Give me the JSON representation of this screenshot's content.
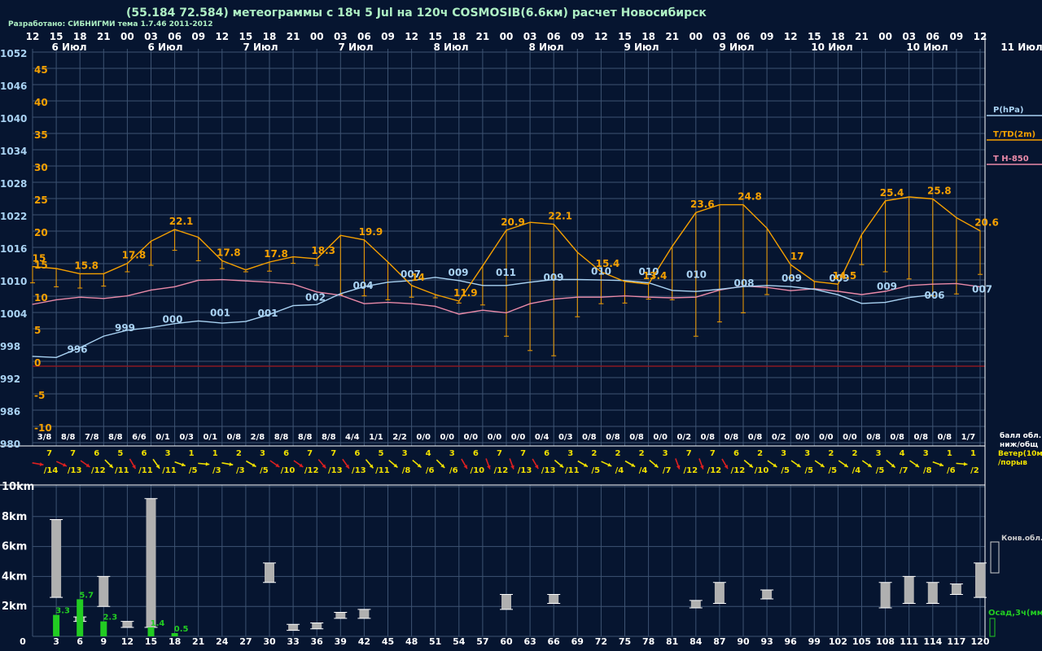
{
  "header": {
    "title": "(55.184 72.584) метеограммы с  18ч 5 Jul на 120ч COSMOSIB(6.6км) расчет Новосибирск",
    "credits": "Разработано: СИБНИГМИ тема 1.7.46 2011-2012"
  },
  "colors": {
    "background": "#061530",
    "grid": "#3d5372",
    "pressure": "#a9d2f2",
    "temperature": "#f5a000",
    "t850": "#ea8aa8",
    "zero_line": "#8a1a22",
    "cloud_bar": "#b0b0b0",
    "precip_bar": "#22cc22",
    "wind_calm": "#f0e000",
    "wind_strong": "#dd2020"
  },
  "chart_data": [
    {
      "type": "line",
      "name": "meteogram-main",
      "hour_ticks": [
        "12",
        "15",
        "18",
        "21",
        "00",
        "03",
        "06",
        "09",
        "12",
        "15",
        "18",
        "21",
        "00",
        "03",
        "06",
        "09",
        "12",
        "15",
        "18",
        "21",
        "00",
        "03",
        "06",
        "09",
        "12",
        "15",
        "18",
        "21",
        "00",
        "03",
        "06",
        "09",
        "12",
        "15",
        "18",
        "21",
        "00",
        "03",
        "06",
        "09",
        "12"
      ],
      "day_labels": [
        "6 Июл",
        "6 Июл",
        "7 Июл",
        "7 Июл",
        "8 Июл",
        "8 Июл",
        "9 Июл",
        "9 Июл",
        "10 Июл",
        "10 Июл",
        "11 Июл"
      ],
      "pressure_axis_label": "P(hPa)",
      "temp_axis_label": "T/TD(2m)",
      "t850_axis_label": "T H-850",
      "pressure_ticks": [
        "1052",
        "1046",
        "1040",
        "1034",
        "1028",
        "1022",
        "1016",
        "1010",
        "1004",
        "998",
        "992",
        "986",
        "980"
      ],
      "temp_ticks": [
        "45",
        "40",
        "35",
        "30",
        "25",
        "20",
        "15",
        "10",
        "5",
        "0",
        "-5",
        "-10"
      ],
      "pressure_hpa": [
        996.8,
        996.6,
        998.4,
        1000.5,
        1001.6,
        1002.1,
        1002.8,
        1003.3,
        1002.9,
        1003.2,
        1004.5,
        1006.1,
        1006.3,
        1008.3,
        1009.6,
        1010.4,
        1010.7,
        1011.3,
        1010.7,
        1009.8,
        1009.8,
        1010.4,
        1010.9,
        1010.9,
        1010.8,
        1010.7,
        1010.3,
        1008.9,
        1008.7,
        1009.1,
        1009.6,
        1009.8,
        1009.6,
        1009.1,
        1008.1,
        1006.5,
        1006.7,
        1007.6,
        1008.1
      ],
      "temperature_c": [
        15.3,
        15.0,
        14.2,
        14.2,
        15.8,
        19.2,
        21.0,
        19.8,
        16.2,
        14.8,
        16.0,
        16.8,
        16.5,
        20.1,
        19.4,
        16.0,
        12.4,
        11.0,
        10.0,
        15.4,
        20.9,
        22.1,
        21.8,
        17.5,
        14.5,
        13.0,
        12.6,
        18.4,
        23.6,
        24.8,
        24.8,
        21.2,
        15.6,
        13.0,
        12.6,
        20.2,
        25.4,
        26.0,
        25.7,
        22.8,
        20.8
      ],
      "dewpoint_c": [
        12.8,
        12.2,
        12.0,
        12.3,
        14.5,
        15.5,
        17.8,
        16.2,
        15.0,
        14.5,
        14.6,
        15.8,
        15.5,
        11.0,
        10.8,
        10.2,
        10.6,
        10.5,
        9.7,
        9.4,
        4.6,
        2.4,
        1.6,
        7.6,
        9.6,
        9.7,
        10.3,
        10.2,
        4.6,
        6.8,
        8.2,
        11.0,
        13.6,
        11.8,
        11.5,
        15.6,
        14.5,
        13.4,
        10.8,
        11.1,
        14.1
      ],
      "t850_c": [
        9.5,
        10.2,
        10.6,
        10.4,
        10.8,
        11.7,
        12.2,
        13.2,
        13.3,
        13.1,
        12.9,
        12.6,
        11.4,
        10.9,
        9.6,
        9.8,
        9.6,
        9.2,
        8.0,
        8.6,
        8.2,
        9.6,
        10.3,
        10.6,
        10.6,
        10.8,
        10.6,
        10.5,
        10.6,
        11.7,
        12.3,
        12.1,
        11.6,
        11.9,
        11.5,
        11.0,
        11.5,
        12.4,
        12.6,
        12.7,
        12.2
      ],
      "pressure_labels": [
        {
          "h": 6,
          "v": "996"
        },
        {
          "h": 15,
          "v": "999"
        },
        {
          "h": 24,
          "v": "000"
        },
        {
          "h": 33,
          "v": "001"
        },
        {
          "h": 42,
          "v": "001"
        },
        {
          "h": 51,
          "v": "002"
        },
        {
          "h": 60,
          "v": "004"
        },
        {
          "h": 69,
          "v": "007"
        },
        {
          "h": 78,
          "v": "009"
        },
        {
          "h": 87,
          "v": "011"
        },
        {
          "h": 96,
          "v": "009"
        },
        {
          "h": 105,
          "v": "010"
        },
        {
          "h": 114,
          "v": "010"
        },
        {
          "h": 123,
          "v": "010"
        },
        {
          "h": 132,
          "v": "008"
        },
        {
          "h": 141,
          "v": "009"
        },
        {
          "h": 150,
          "v": "009"
        },
        {
          "h": 159,
          "v": "009"
        },
        {
          "h": 168,
          "v": "006"
        },
        {
          "h": 177,
          "v": "007"
        }
      ],
      "temperature_labels": [
        {
          "h": 0,
          "v": "15"
        },
        {
          "h": 9,
          "v": "15.8"
        },
        {
          "h": 18,
          "v": "17.8"
        },
        {
          "h": 27,
          "v": "22.1"
        },
        {
          "h": 36,
          "v": "17.8"
        },
        {
          "h": 45,
          "v": "17.8"
        },
        {
          "h": 54,
          "v": "18.3"
        },
        {
          "h": 63,
          "v": "19.9"
        },
        {
          "h": 72,
          "v": "14"
        },
        {
          "h": 81,
          "v": "11.9"
        },
        {
          "h": 90,
          "v": "20.9"
        },
        {
          "h": 99,
          "v": "22.1"
        },
        {
          "h": 108,
          "v": "15.4"
        },
        {
          "h": 117,
          "v": "13.4"
        },
        {
          "h": 126,
          "v": "23.6"
        },
        {
          "h": 135,
          "v": "24.8"
        },
        {
          "h": 144,
          "v": "17"
        },
        {
          "h": 153,
          "v": "14.5"
        },
        {
          "h": 162,
          "v": "25.4"
        },
        {
          "h": 171,
          "v": "25.8"
        },
        {
          "h": 180,
          "v": "20.6"
        }
      ],
      "cloud_cover": [
        "3/8",
        "8/8",
        "7/8",
        "8/8",
        "6/6",
        "0/1",
        "0/3",
        "0/1",
        "0/8",
        "2/8",
        "8/8",
        "8/8",
        "8/8",
        "4/4",
        "1/1",
        "2/2",
        "0/0",
        "0/0",
        "0/0",
        "0/0",
        "0/0",
        "0/4",
        "0/3",
        "0/8",
        "0/8",
        "0/8",
        "0/0",
        "0/2",
        "0/8",
        "0/8",
        "0/8",
        "0/2",
        "0/0",
        "0/0",
        "0/0",
        "0/8",
        "0/8",
        "0/8",
        "0/8",
        "1/7"
      ],
      "cloud_cover_label": [
        "балл обл.",
        "ниж/общ"
      ]
    },
    {
      "type": "wind",
      "name": "wind-row",
      "label": [
        "Ветер(10м)",
        "/порыв"
      ],
      "speed": [
        "7",
        "7",
        "6",
        "5",
        "6",
        "3",
        "1",
        "1",
        "2",
        "3",
        "6",
        "7",
        "7",
        "6",
        "5",
        "3",
        "4",
        "3",
        "6",
        "7",
        "7",
        "6",
        "3",
        "2",
        "2",
        "2",
        "3",
        "7",
        "7",
        "6",
        "2",
        "3",
        "3",
        "2",
        "2",
        "3",
        "4",
        "3",
        "1",
        "1"
      ],
      "gust": [
        "/14",
        "/13",
        "/12",
        "/11",
        "/11",
        "/11",
        "/5",
        "/3",
        "/3",
        "/5",
        "/10",
        "/12",
        "/13",
        "/13",
        "/11",
        "/8",
        "/6",
        "/6",
        "/10",
        "/12",
        "/13",
        "/13",
        "/11",
        "/5",
        "/4",
        "/4",
        "/7",
        "/12",
        "/12",
        "/12",
        "/10",
        "/5",
        "/5",
        "/5",
        "/4",
        "/5",
        "/7",
        "/8",
        "/6",
        "/2"
      ],
      "direction_deg": [
        100,
        115,
        125,
        135,
        150,
        145,
        110,
        95,
        100,
        120,
        125,
        125,
        140,
        145,
        140,
        130,
        130,
        135,
        150,
        160,
        160,
        150,
        130,
        120,
        115,
        120,
        130,
        160,
        160,
        150,
        130,
        125,
        125,
        125,
        125,
        125,
        130,
        125,
        110,
        95
      ]
    },
    {
      "type": "bar",
      "name": "clouds-precip",
      "x_ticks": [
        "0",
        "3",
        "6",
        "9",
        "12",
        "15",
        "18",
        "21",
        "24",
        "27",
        "30",
        "33",
        "36",
        "39",
        "42",
        "45",
        "48",
        "51",
        "54",
        "57",
        "60",
        "63",
        "66",
        "69",
        "72",
        "75",
        "78",
        "81",
        "84",
        "87",
        "90",
        "93",
        "96",
        "99",
        "102",
        "105",
        "108",
        "111",
        "114",
        "117",
        "120"
      ],
      "height_ticks": [
        "10km",
        "8km",
        "6km",
        "4km",
        "2km"
      ],
      "ylim_km": [
        0,
        10
      ],
      "cloud_label": "Конв.обл.",
      "precip_label": "Осад,3ч(мм)",
      "clouds": [
        {
          "x": 3,
          "base": 2.6,
          "top": 7.8
        },
        {
          "x": 6,
          "base": 1.0,
          "top": 1.3
        },
        {
          "x": 9,
          "base": 2.0,
          "top": 4.0
        },
        {
          "x": 12,
          "base": 0.6,
          "top": 1.0
        },
        {
          "x": 15,
          "base": 0.6,
          "top": 9.2
        },
        {
          "x": 30,
          "base": 3.6,
          "top": 4.9
        },
        {
          "x": 33,
          "base": 0.4,
          "top": 0.8
        },
        {
          "x": 36,
          "base": 0.5,
          "top": 0.9
        },
        {
          "x": 39,
          "base": 1.2,
          "top": 1.6
        },
        {
          "x": 42,
          "base": 1.2,
          "top": 1.8
        },
        {
          "x": 60,
          "base": 1.8,
          "top": 2.8
        },
        {
          "x": 66,
          "base": 2.2,
          "top": 2.8
        },
        {
          "x": 84,
          "base": 1.9,
          "top": 2.4
        },
        {
          "x": 87,
          "base": 2.2,
          "top": 3.6
        },
        {
          "x": 93,
          "base": 2.5,
          "top": 3.1
        },
        {
          "x": 108,
          "base": 1.9,
          "top": 3.6
        },
        {
          "x": 111,
          "base": 2.2,
          "top": 4.0
        },
        {
          "x": 114,
          "base": 2.2,
          "top": 3.6
        },
        {
          "x": 117,
          "base": 2.8,
          "top": 3.5
        },
        {
          "x": 120,
          "base": 2.6,
          "top": 4.9
        }
      ],
      "precip": [
        {
          "x": 3,
          "v": 3.3,
          "label": "3.3"
        },
        {
          "x": 6,
          "v": 5.7,
          "label": "5.7"
        },
        {
          "x": 9,
          "v": 2.3,
          "label": "2.3"
        },
        {
          "x": 15,
          "v": 1.4,
          "label": "1.4"
        },
        {
          "x": 18,
          "v": 0.5,
          "label": "0.5"
        }
      ]
    }
  ]
}
